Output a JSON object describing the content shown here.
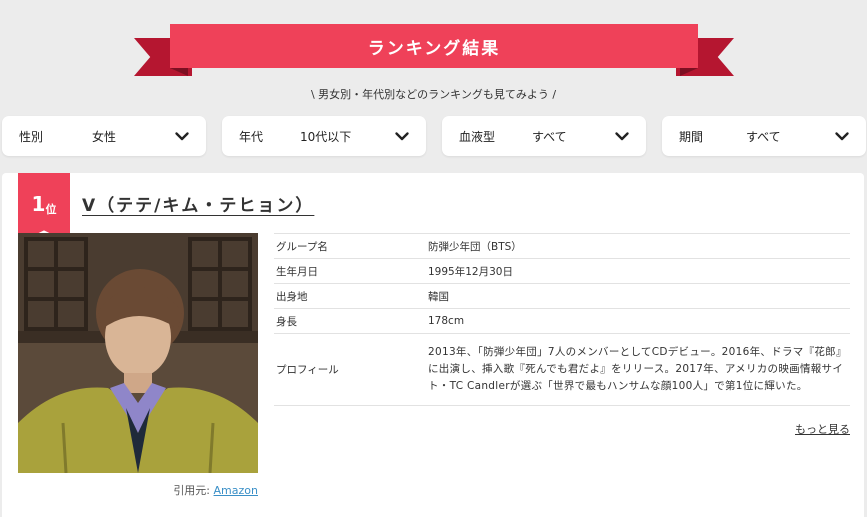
{
  "banner": {
    "title": "ランキング結果"
  },
  "subtitle": "\\ 男女別・年代別などのランキングも見てみよう /",
  "filters": [
    {
      "label": "性別",
      "value": "女性"
    },
    {
      "label": "年代",
      "value": "10代以下"
    },
    {
      "label": "血液型",
      "value": "すべて"
    },
    {
      "label": "期間",
      "value": "すべて"
    }
  ],
  "result": {
    "rank_number": "1",
    "rank_suffix": "位",
    "name": "V（テテ/キム・テヒョン）",
    "credit_prefix": "引用元:",
    "credit_link": "Amazon",
    "rows": [
      {
        "key": "グループ名",
        "value": "防弾少年団（BTS）"
      },
      {
        "key": "生年月日",
        "value": "1995年12月30日"
      },
      {
        "key": "出身地",
        "value": "韓国"
      },
      {
        "key": "身長",
        "value": "178cm"
      },
      {
        "key": "プロフィール",
        "value": "2013年、「防弾少年団」7人のメンバーとしてCDデビュー。2016年、ドラマ『花郎』に出演し、挿入歌『死んでも君だよ』をリリース。2017年、アメリカの映画情報サイト・TC Candlerが選ぶ「世界で最もハンサムな顔100人」で第1位に輝いた。"
      }
    ],
    "more_label": "もっと見る"
  },
  "colors": {
    "accent": "#ef4159",
    "accent_dark": "#b51630",
    "background": "#ececec",
    "link": "#3a8fc7"
  },
  "icons": {
    "filter_toggle": "chevron-down-icon"
  }
}
